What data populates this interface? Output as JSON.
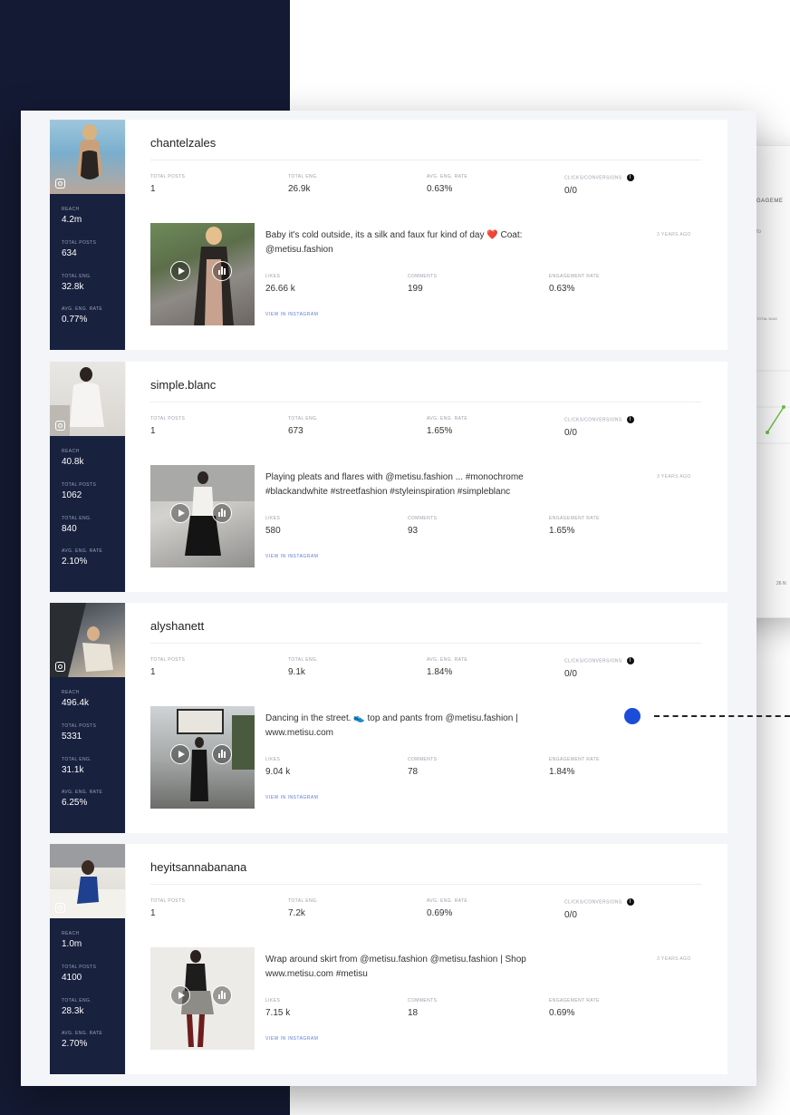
{
  "background_panel": {
    "header_text": "GAGEME",
    "filter_text": "to",
    "axis_label": "TOTAL NUM",
    "x_tick": "26 N"
  },
  "colors": {
    "navy": "#141a33",
    "sidebar": "#18213d",
    "accent_dot": "#1c4dd8",
    "link": "#5a7dd6"
  },
  "labels": {
    "reach": "REACH",
    "total_posts": "TOTAL POSTS",
    "total_eng": "TOTAL ENG.",
    "avg_eng_rate": "AVG. ENG. RATE",
    "clicks_conversions": "CLICKS/CONVERSIONS",
    "likes": "LIKES",
    "comments": "COMMENTS",
    "engagement_rate": "ENGAGEMENT RATE",
    "view_in_instagram": "VIEW IN INSTAGRAM"
  },
  "influencers": [
    {
      "username": "chantelzales",
      "sidebar": {
        "reach": "4.2m",
        "total_posts": "634",
        "total_eng": "32.8k",
        "avg_eng_rate": "0.77%"
      },
      "stats": {
        "total_posts": "1",
        "total_eng": "26.9k",
        "avg_eng_rate": "0.63%",
        "clicks_conversions": "0/0"
      },
      "post": {
        "caption": "Baby it's cold outside, its a silk and faux fur kind of day ❤️ Coat: @metisu.fashion",
        "age": "3 YEARS AGO",
        "likes": "26.66 k",
        "comments": "199",
        "engagement_rate": "0.63%"
      }
    },
    {
      "username": "simple.blanc",
      "sidebar": {
        "reach": "40.8k",
        "total_posts": "1062",
        "total_eng": "840",
        "avg_eng_rate": "2.10%"
      },
      "stats": {
        "total_posts": "1",
        "total_eng": "673",
        "avg_eng_rate": "1.65%",
        "clicks_conversions": "0/0"
      },
      "post": {
        "caption": "Playing pleats and flares with @metisu.fashion ... #monochrome #blackandwhite #streetfashion #styleinspiration #simpleblanc",
        "age": "3 YEARS AGO",
        "likes": "580",
        "comments": "93",
        "engagement_rate": "1.65%"
      }
    },
    {
      "username": "alyshanett",
      "sidebar": {
        "reach": "496.4k",
        "total_posts": "5331",
        "total_eng": "31.1k",
        "avg_eng_rate": "6.25%"
      },
      "stats": {
        "total_posts": "1",
        "total_eng": "9.1k",
        "avg_eng_rate": "1.84%",
        "clicks_conversions": "0/0"
      },
      "post": {
        "caption": "Dancing in the street. 👟 top and pants from @metisu.fashion | www.metisu.com",
        "age": "3 YEARS AGO",
        "likes": "9.04 k",
        "comments": "78",
        "engagement_rate": "1.84%"
      }
    },
    {
      "username": "heyitsannabanana",
      "sidebar": {
        "reach": "1.0m",
        "total_posts": "4100",
        "total_eng": "28.3k",
        "avg_eng_rate": "2.70%"
      },
      "stats": {
        "total_posts": "1",
        "total_eng": "7.2k",
        "avg_eng_rate": "0.69%",
        "clicks_conversions": "0/0"
      },
      "post": {
        "caption": "Wrap around skirt from @metisu.fashion @metisu.fashion | Shop www.metisu.com #metisu",
        "age": "3 YEARS AGO",
        "likes": "7.15 k",
        "comments": "18",
        "engagement_rate": "0.69%"
      }
    }
  ]
}
